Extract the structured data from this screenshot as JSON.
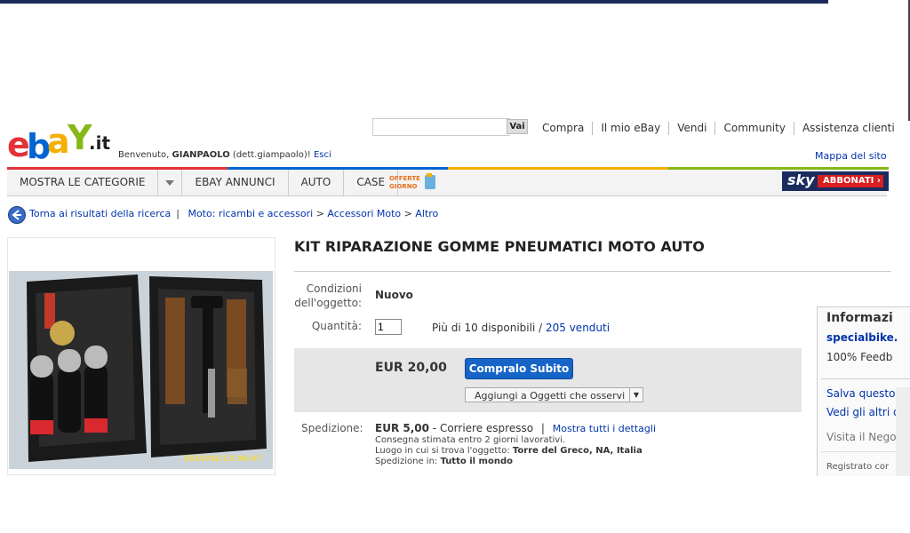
{
  "header": {
    "logo_letters": [
      "e",
      "b",
      "a",
      "Y"
    ],
    "logo_suffix": ".it",
    "logo_colors": [
      "#e53238",
      "#0064d2",
      "#f5af02",
      "#86b817"
    ],
    "welcome_prefix": "Benvenuto,",
    "welcome_user": "GIANPAOLO",
    "welcome_detail": "(dett.giampaolo)!",
    "logout_label": "Esci",
    "search_placeholder": "",
    "search_button": "Vai",
    "top_links": [
      "Compra",
      "Il mio eBay",
      "Vendi",
      "Community",
      "Assistenza clienti"
    ],
    "sitemap_label": "Mappa del sito"
  },
  "nav": {
    "tabs": [
      "MOSTRA LE CATEGORIE",
      "EBAY ANNUNCI",
      "AUTO",
      "CASE"
    ],
    "offerte_label": "OFFERTE DEL GIORNO",
    "sky_logo": "sky",
    "sky_button": "ABBONATI ›"
  },
  "breadcrumb": {
    "back_label": "Torna ai risultati della ricerca",
    "path": [
      "Moto: ricambi e accessori",
      "Accessori Moto",
      "Altro"
    ]
  },
  "item": {
    "title": "KIT RIPARAZIONE GOMME PNEUMATICI MOTO AUTO",
    "photo_stamp": "2010/02/13  08:47",
    "condition_label_1": "Condizioni",
    "condition_label_2": "dell'oggetto:",
    "condition_value": "Nuovo",
    "quantity_label": "Quantità:",
    "quantity_value": "1",
    "availability": "Più di 10 disponibili /",
    "sold": "205 venduti",
    "price": "EUR 20,00",
    "buy_button": "Compralo Subito",
    "watch_button": "Aggiungi a Oggetti che osservi"
  },
  "shipping": {
    "label": "Spedizione:",
    "cost": "EUR 5,00",
    "method": "- Corriere espresso",
    "details_link": "Mostra tutti i dettagli",
    "delivery": "Consegna stimata entro 2 giorni lavorativi.",
    "location_label": "Luogo in cui si trova l'oggetto:",
    "location": "Torre del Greco, NA, Italia",
    "ships_to_label": "Spedizione in:",
    "ships_to": "Tutto il mondo"
  },
  "seller": {
    "heading": "Informazi",
    "name": "specialbike.",
    "feedback": "100% Feedb",
    "save": "Salva questo",
    "view_items": "Vedi gli altri o",
    "store": "Visita il Nego",
    "registered": "Registrato cor"
  },
  "colors": {
    "link": "#0033aa",
    "buy_button": "#1664c8",
    "price_box": "#e6e6e6",
    "sky_navy": "#1a2c5e",
    "sky_red": "#d81e1e"
  }
}
